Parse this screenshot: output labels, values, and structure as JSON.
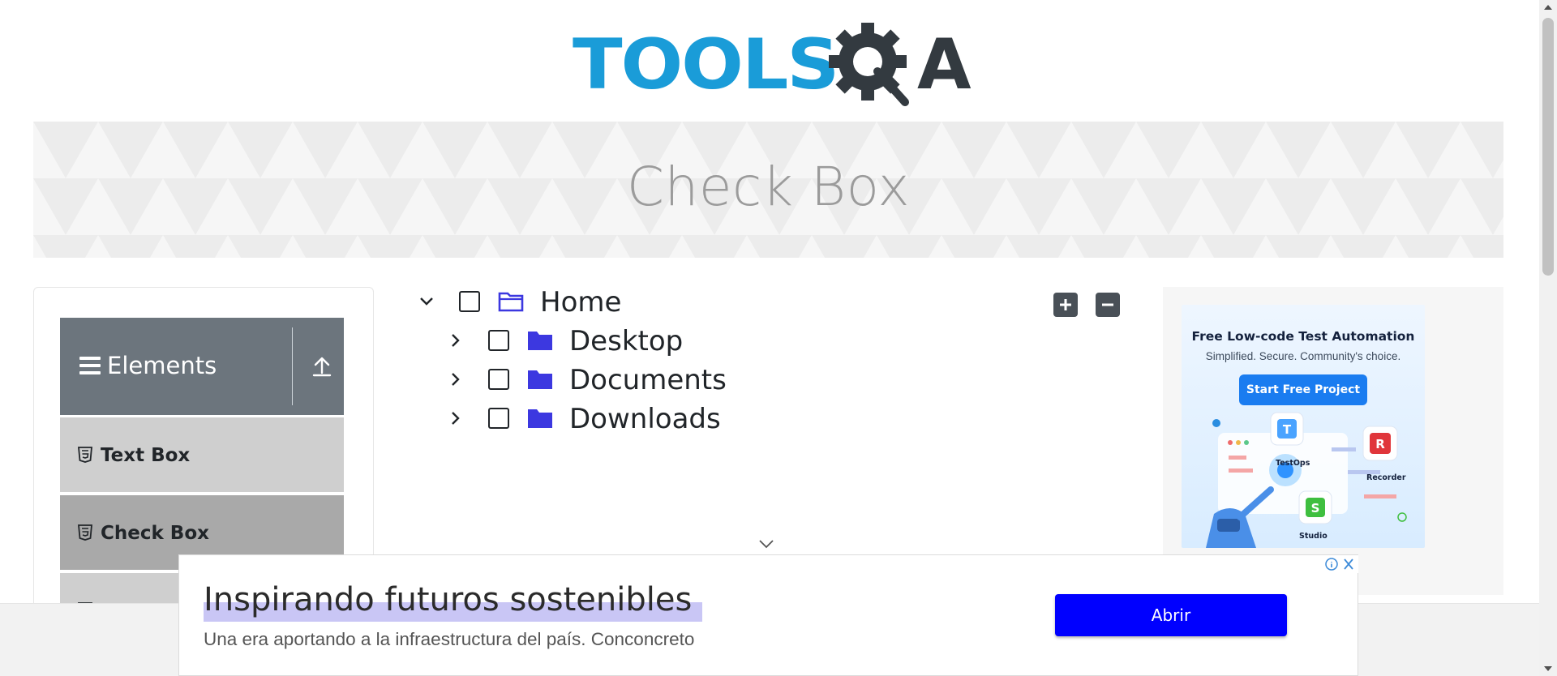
{
  "logo": {
    "text": "TOOLS",
    "suffix": "A",
    "primary_color": "#1a9cd8",
    "secondary_color": "#333a40"
  },
  "banner": {
    "title": "Check Box"
  },
  "sidebar": {
    "group_title": "Elements",
    "items": [
      {
        "label": "Text Box"
      },
      {
        "label": "Check Box",
        "active": true
      },
      {
        "label": ""
      }
    ]
  },
  "tree": {
    "nodes": [
      {
        "label": "Home",
        "expanded": true,
        "checked": false
      },
      {
        "label": "Desktop",
        "expanded": false,
        "checked": false
      },
      {
        "label": "Documents",
        "expanded": false,
        "checked": false
      },
      {
        "label": "Downloads",
        "expanded": false,
        "checked": false
      }
    ],
    "folder_color": "#3c38e0"
  },
  "toolbar": {
    "expand_all_icon": "plus-icon",
    "collapse_all_icon": "minus-icon"
  },
  "side_ad": {
    "title": "Free Low-code Test Automation",
    "subtitle": "Simplified. Secure. Community's choice.",
    "button": "Start Free Project",
    "labels": [
      "TestOps",
      "Recorder",
      "Studio"
    ]
  },
  "bottom_ad": {
    "headline": "Inspirando futuros sostenibles",
    "body": "Una era aportando a la infraestructura del país. Conconcreto",
    "cta": "Abrir",
    "cta_color": "#0000ff"
  }
}
